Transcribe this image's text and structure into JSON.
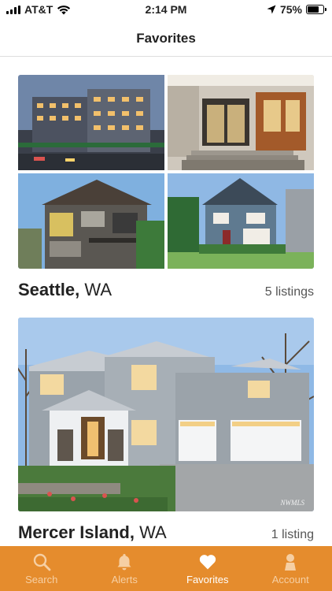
{
  "status_bar": {
    "carrier": "AT&T",
    "time": "2:14 PM",
    "battery": "75%",
    "battery_level": 0.75
  },
  "nav": {
    "title": "Favorites"
  },
  "favorites": [
    {
      "city": "Seattle,",
      "state": "WA",
      "count": "5 listings"
    },
    {
      "city": "Mercer Island,",
      "state": "WA",
      "count": "1 listing"
    }
  ],
  "photo_watermark": "NWMLS",
  "tabs": [
    {
      "label": "Search",
      "icon": "search-icon",
      "active": false
    },
    {
      "label": "Alerts",
      "icon": "bell-icon",
      "active": false
    },
    {
      "label": "Favorites",
      "icon": "heart-icon",
      "active": true
    },
    {
      "label": "Account",
      "icon": "person-icon",
      "active": false
    }
  ],
  "colors": {
    "accent": "#e58c2d",
    "tab_inactive": "#f6cfa3",
    "tab_active": "#ffffff"
  }
}
